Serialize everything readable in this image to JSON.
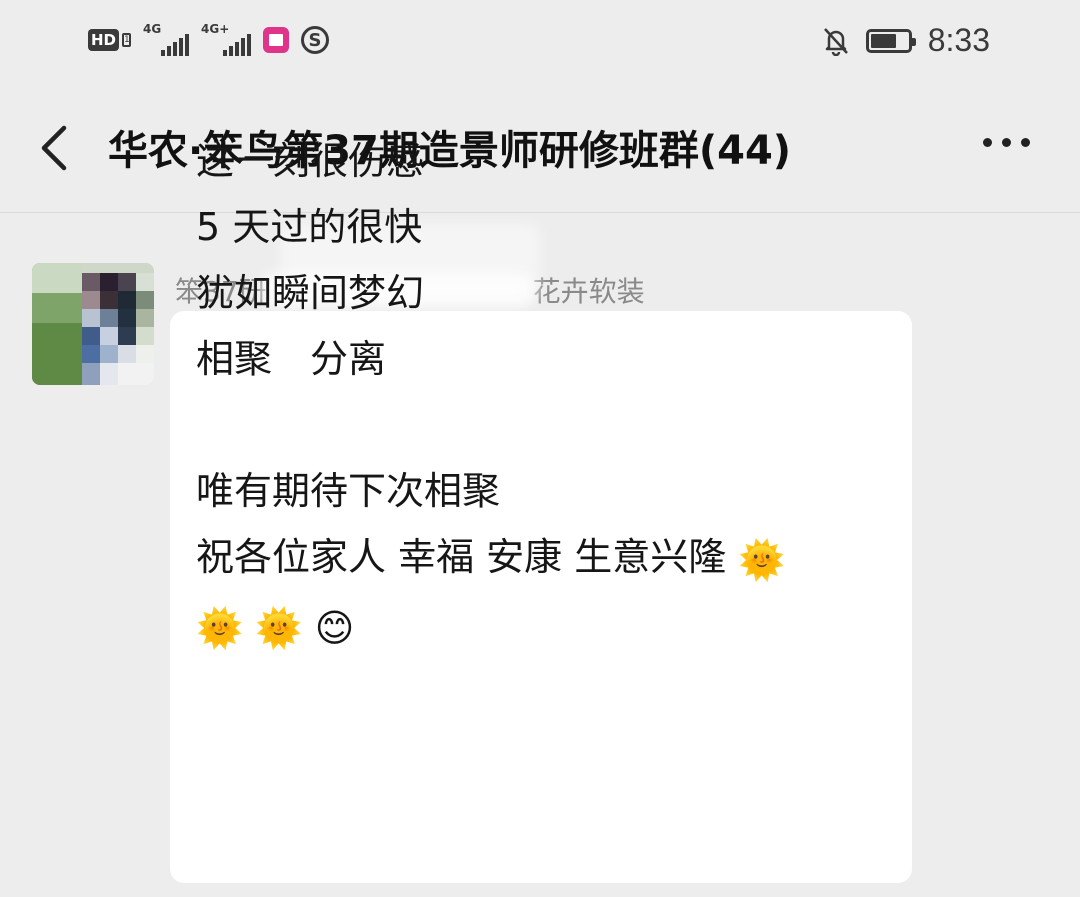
{
  "status_bar": {
    "hd_label": "HD",
    "hd_sub": "1",
    "net1": "4G",
    "net2": "4G+",
    "s_icon": "S",
    "time": "8:33",
    "icons": [
      "hd-icon",
      "signal-icon",
      "signal-icon",
      "app-notification-icon",
      "s-app-icon",
      "bell-off-icon",
      "battery-icon"
    ],
    "battery_level": 0.7
  },
  "nav": {
    "title": "华农·笨鸟第37期造景师研修班群(44)",
    "back_icon": "chevron-left-icon",
    "more_icon": "more-dots-icon"
  },
  "message": {
    "sender_name_prefix": "笨37研",
    "sender_name_suffix": "花卉软装",
    "lines": [
      "这一刻很伤感",
      "5 天过的很快",
      "犹如瞬间梦幻",
      "相聚　分离",
      "",
      "唯有期待下次相聚",
      "祝各位家人 幸福 安康 生意兴隆 "
    ],
    "emoji_trailing": "🌞",
    "emoji_line2": "🌞 🌞 😊"
  },
  "colors": {
    "background": "#ededed",
    "bubble": "#ffffff",
    "name_gray": "#8a8a8a",
    "text": "#161616"
  }
}
